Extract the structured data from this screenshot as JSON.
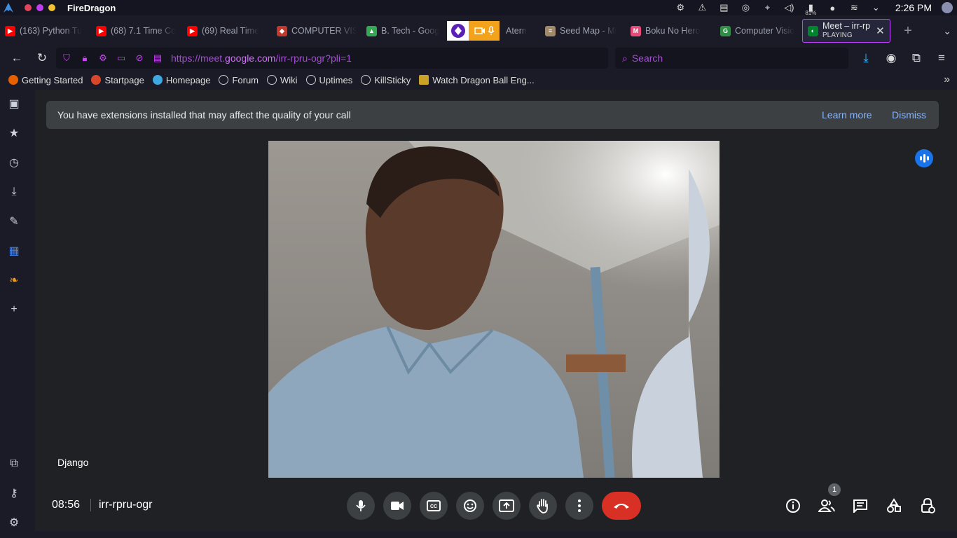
{
  "system": {
    "app_name": "FireDragon",
    "battery": "81%",
    "clock": "2:26 PM",
    "dots": [
      "#e0455b",
      "#c13ef0",
      "#f2c230"
    ]
  },
  "tabs": [
    {
      "title": "(163) Python Tu",
      "icon": "youtube-icon",
      "color": "#ff0000"
    },
    {
      "title": "(68) 7.1 Time Co",
      "icon": "youtube-icon",
      "color": "#ff0000"
    },
    {
      "title": "(69) Real Time",
      "icon": "youtube-icon",
      "color": "#ff0000"
    },
    {
      "title": "COMPUTER VIS",
      "icon": "shield-icon",
      "color": "#c0392b"
    },
    {
      "title": "B. Tech - Goog",
      "icon": "drive-icon",
      "color": "#34a853"
    },
    {
      "title": "Atern",
      "icon": "server-icon",
      "color": "#888888"
    },
    {
      "title": "Seed Map - Mi",
      "icon": "map-icon",
      "color": "#a0886a"
    },
    {
      "title": "Boku No Hero",
      "icon": "manga-icon",
      "color": "#e84a7a"
    },
    {
      "title": "Computer Visio",
      "icon": "gfg-icon",
      "color": "#2f8d46"
    }
  ],
  "active_tab": {
    "title": "Meet – irr-rp",
    "subtitle": "PLAYING"
  },
  "url": {
    "prefix": "https://meet.",
    "domain": "google.com",
    "path": "/irr-rpru-ogr?pli=1"
  },
  "search_placeholder": "Search",
  "bookmarks": [
    {
      "label": "Getting Started",
      "icon": "firefox-icon"
    },
    {
      "label": "Startpage",
      "icon": "startpage-icon"
    },
    {
      "label": "Homepage",
      "icon": "homepage-icon"
    },
    {
      "label": "Forum",
      "icon": "globe-icon"
    },
    {
      "label": "Wiki",
      "icon": "globe-icon"
    },
    {
      "label": "Uptimes",
      "icon": "globe-icon"
    },
    {
      "label": "KillSticky",
      "icon": "globe-icon"
    },
    {
      "label": "Watch Dragon Ball Eng...",
      "icon": "dragon-icon"
    }
  ],
  "meet": {
    "banner": "You have extensions installed that may affect the quality of your call",
    "learn_more": "Learn more",
    "dismiss": "Dismiss",
    "participant_name": "Django",
    "time": "08:56",
    "meeting_code": "irr-rpru-ogr",
    "participant_count": "1"
  }
}
